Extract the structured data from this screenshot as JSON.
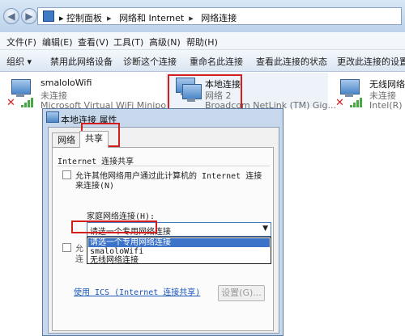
{
  "address": {
    "crumbs": [
      "控制面板",
      "网络和 Internet",
      "网络连接"
    ],
    "arrow": "▸"
  },
  "menu": [
    "文件(F)",
    "编辑(E)",
    "查看(V)",
    "工具(T)",
    "高级(N)",
    "帮助(H)"
  ],
  "commands": [
    "组织 ▾",
    "禁用此网络设备",
    "诊断这个连接",
    "重命名此连接",
    "查看此连接的状态",
    "更改此连接的设置"
  ],
  "adapters": [
    {
      "name": "smaloloWifi",
      "status": "未连接",
      "device": "Microsoft Virtual WiFi Miniport"
    },
    {
      "name": "本地连接",
      "status": "网络 2",
      "device": "Broadcom NetLink (TM) Gig..."
    },
    {
      "name": "无线网络连",
      "status": "未连接",
      "device": "Intel(R) W"
    }
  ],
  "dialog": {
    "title": "本地连接 属性",
    "tabs": [
      "网络",
      "共享"
    ],
    "section_title": "Internet 连接共享",
    "allow_line1": "允许其他网络用户通过此计算机的 Internet 连接",
    "allow_line2": "来连接(N)",
    "home_label": "家庭网络连接(H):",
    "dropdown_value": "请选一个专用网络连接",
    "options": [
      "请选一个专用网络连接",
      "smaloloWifi",
      "无线网络连接"
    ],
    "control_line1": "允",
    "control_line2": "连",
    "ics_link": "使用 ICS (Internet 连接共享)",
    "settings_button": "设置(G)..."
  },
  "colors": {
    "highlight": "#d41d1d",
    "selection": "#3a73c8",
    "link": "#1b56b8"
  }
}
